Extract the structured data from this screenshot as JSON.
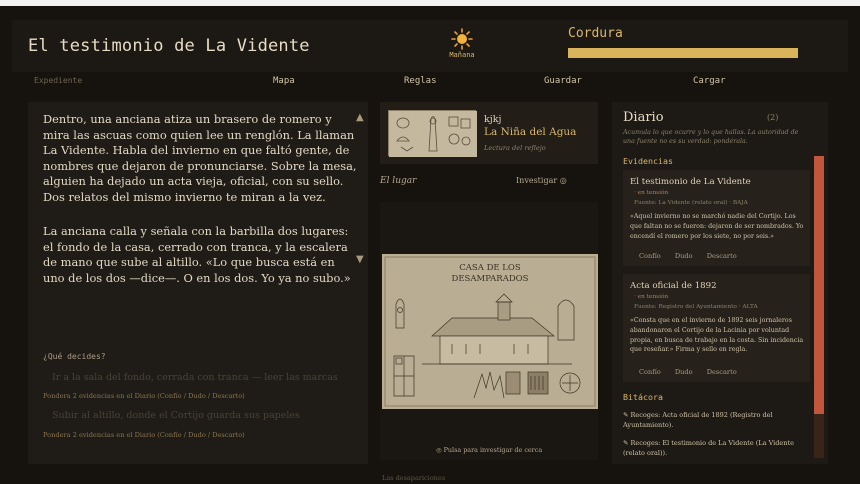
{
  "title": "El testimonio de La Vidente",
  "time_of_day": "Mañana",
  "sanity": {
    "label": "Cordura",
    "level_percent": 100,
    "fill_color": "#d9b45a"
  },
  "nav": {
    "expediente": "Expediente",
    "mapa": "Mapa",
    "reglas": "Reglas",
    "guardar": "Guardar",
    "cargar": "Cargar"
  },
  "story": {
    "paragraph1": "Dentro, una anciana atiza un brasero de romero y mira las ascuas como quien lee un renglón. La llaman La Vidente. Habla del invierno en que faltó gente, de nombres que dejaron de pronunciarse. Sobre la mesa, alguien ha dejado un acta vieja, oficial, con su sello. Dos relatos del mismo invierno te miran a la vez.",
    "paragraph2": "La anciana calla y señala con la barbilla dos lugares: el fondo de la casa, cerrado con tranca, y la escalera de mano que sube al altillo. «Lo que busca está en uno de los dos —dice—. O en los dos. Yo ya no subo.»",
    "scroll_up": "▲",
    "scroll_down": "▼",
    "decide_label": "¿Qué decides?",
    "options": [
      {
        "label": "Ir a la sala del fondo, cerrada con tranca — leer las marcas",
        "requirement": "Pondera 2 evidencias en el Diario (Confío / Dudo / Descarto)"
      },
      {
        "label": "Subir al altillo, donde el Cortijo guarda sus papeles",
        "requirement": "Pondera 2 evidencias en el Diario (Confío / Dudo / Descarto)"
      }
    ]
  },
  "character": {
    "user": "kjkj",
    "name": "La Niña del Agua",
    "subtitle": "Lectura del reflejo"
  },
  "place": {
    "label": "El lugar",
    "investigate": "Investigar ◎",
    "map_title_line1": "CASA DE LOS",
    "map_title_line2": "DESAMPARADOS",
    "hint": "◎ Pulsa para investigar de cerca",
    "below_label": "Las desapariciones"
  },
  "diary": {
    "title": "Diario",
    "count": "(2)",
    "description": "Acumula lo que ocurre y lo que hallas. La autoridad de una fuente no es su verdad: pondérala.",
    "evidence_header": "Evidencias",
    "evidences": [
      {
        "title": "El testimonio de La Vidente",
        "status": "· en tensión",
        "source": "Fuente: La Vidente (relato oral) · BAJA",
        "quote": "«Aquel invierno no se marchó nadie del Cortijo. Los que faltan no se fueron: dejaron de ser nombrados. Yo encendí el romero por los siete, no por seis.»",
        "buttons": [
          "Confío",
          "Dudo",
          "Descarto"
        ]
      },
      {
        "title": "Acta oficial de 1892",
        "status": "· en tensión",
        "source": "Fuente: Registro del Ayuntamiento · ALTA",
        "quote": "«Consta que en el invierno de 1892 seis jornaleros abandonaron el Cortijo de la Lacinia por voluntad propia, en busca de trabajo en la costa. Sin incidencia que reseñar.» Firma y sello en regla.",
        "buttons": [
          "Confío",
          "Dudo",
          "Descarto"
        ]
      }
    ],
    "log_header": "Bitácora",
    "log": [
      "✎ Recoges: Acta oficial de 1892 (Registro del Ayuntamiento).",
      "✎ Recoges: El testimonio de La Vidente (La Vidente (relato oral))."
    ]
  }
}
